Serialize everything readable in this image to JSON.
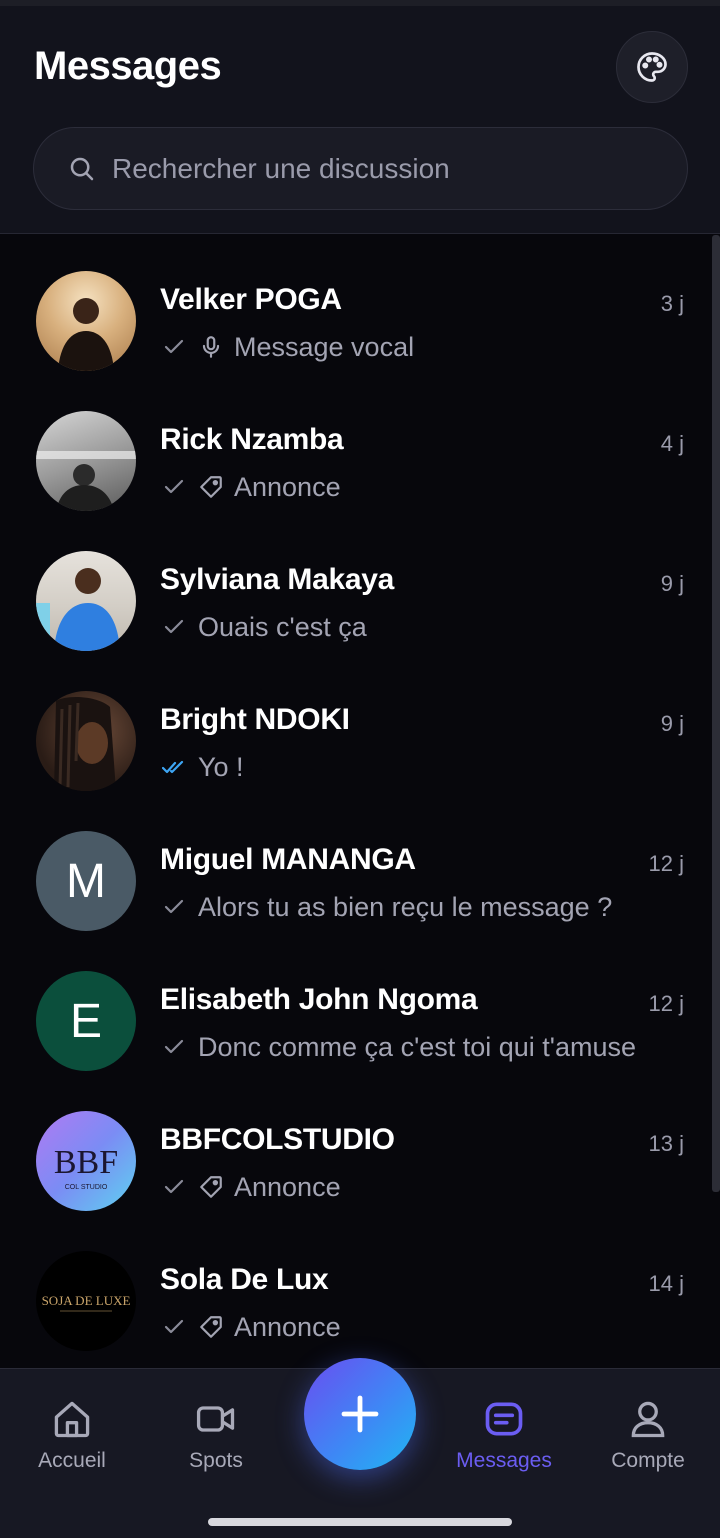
{
  "header": {
    "title": "Messages",
    "palette_icon": "palette-icon"
  },
  "search": {
    "placeholder": "Rechercher une discussion",
    "icon": "search-icon"
  },
  "conversations": [
    {
      "name": "Velker POGA",
      "time": "3 j",
      "status": "sent",
      "type_icon": "microphone-icon",
      "preview": "Message vocal",
      "avatar": {
        "kind": "photo",
        "bg": "#c9a27a"
      }
    },
    {
      "name": "Rick Nzamba",
      "time": "4 j",
      "status": "sent",
      "type_icon": "tag-icon",
      "preview": "Annonce",
      "avatar": {
        "kind": "photo",
        "bg": "#9a9a9a"
      }
    },
    {
      "name": "Sylviana Makaya",
      "time": "9 j",
      "status": "sent",
      "type_icon": "",
      "preview": "Ouais c'est ça",
      "avatar": {
        "kind": "photo",
        "bg": "#3c7fd8"
      }
    },
    {
      "name": "Bright NDOKI",
      "time": "9 j",
      "status": "read",
      "type_icon": "",
      "preview": "Yo !",
      "avatar": {
        "kind": "photo",
        "bg": "#3a2a22"
      }
    },
    {
      "name": "Miguel MANANGA",
      "time": "12 j",
      "status": "sent",
      "type_icon": "",
      "preview": "Alors tu as bien reçu le message ?",
      "avatar": {
        "kind": "initial",
        "letter": "M",
        "bg": "#4a5a66"
      }
    },
    {
      "name": "Elisabeth John Ngoma",
      "time": "12 j",
      "status": "sent",
      "type_icon": "",
      "preview": "Donc comme ça c'est toi qui t'amuse",
      "avatar": {
        "kind": "initial",
        "letter": "E",
        "bg": "#0b4f3c"
      }
    },
    {
      "name": "BBFCOLSTUDIO",
      "time": "13 j",
      "status": "sent",
      "type_icon": "tag-icon",
      "preview": "Annonce",
      "avatar": {
        "kind": "logo",
        "text": "BBF",
        "subtext": "COL STUDIO",
        "bg": "#8a7cf0"
      }
    },
    {
      "name": "Sola De Lux",
      "time": "14 j",
      "status": "sent",
      "type_icon": "tag-icon",
      "preview": "Annonce",
      "avatar": {
        "kind": "logo",
        "text": "SOJA DE LUXE",
        "bg": "#000000"
      }
    }
  ],
  "nav": {
    "items": [
      {
        "label": "Accueil",
        "icon": "home-icon",
        "active": false
      },
      {
        "label": "Spots",
        "icon": "video-camera-icon",
        "active": false
      },
      {
        "label": "Messages",
        "icon": "message-icon",
        "active": true
      },
      {
        "label": "Compte",
        "icon": "user-icon",
        "active": false
      }
    ],
    "fab_icon": "plus-icon"
  },
  "colors": {
    "accent": "#6b5df2",
    "read_check": "#3da5f4",
    "background": "#07070c",
    "header_bg": "#12131c"
  }
}
